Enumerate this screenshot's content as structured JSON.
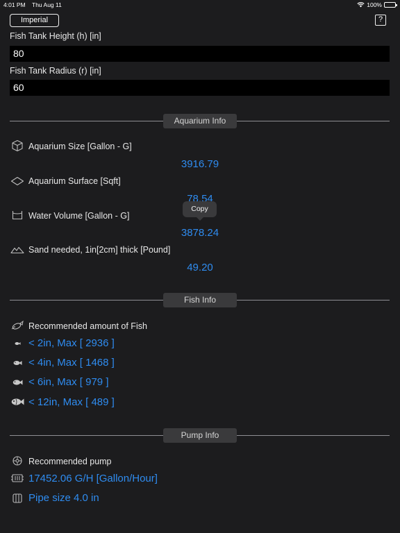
{
  "status_bar": {
    "time": "4:01 PM",
    "date": "Thu Aug 11",
    "battery": "100%"
  },
  "toolbar": {
    "unit_label": "Imperial",
    "help_label": "?"
  },
  "inputs": {
    "height": {
      "label": "Fish Tank Height (h) [in]",
      "value": "80"
    },
    "radius": {
      "label": "Fish Tank Radius (r) [in]",
      "value": "60"
    }
  },
  "aquarium": {
    "header": "Aquarium Info",
    "size": {
      "label": "Aquarium Size [Gallon - G]",
      "value": "3916.79",
      "icon": "cube-icon"
    },
    "surface": {
      "label": "Aquarium Surface [Sqft]",
      "value": "78.54",
      "icon": "diamond-icon"
    },
    "water": {
      "label": "Water Volume [Gallon - G]",
      "value": "3878.24",
      "icon": "tank-icon"
    },
    "sand": {
      "label": "Sand needed, 1in[2cm] thick [Pound]",
      "value": "49.20",
      "icon": "sand-icon"
    },
    "tooltip": "Copy"
  },
  "fish": {
    "header": "Fish Info",
    "title": "Recommended amount of Fish",
    "rows": [
      {
        "label": "< 2in, Max [ 2936 ]",
        "icon": "small-fish-icon"
      },
      {
        "label": "< 4in, Max [ 1468 ]",
        "icon": "fish-icon"
      },
      {
        "label": "< 6in, Max [ 979 ]",
        "icon": "fish-icon"
      },
      {
        "label": "< 12in, Max [ 489 ]",
        "icon": "large-fish-icon"
      }
    ]
  },
  "pump": {
    "header": "Pump Info",
    "title": "Recommended pump",
    "flow": "17452.06 G/H [Gallon/Hour]",
    "pipe": "Pipe size 4.0 in"
  },
  "colors": {
    "background": "#1c1c1e",
    "accent": "#2f8cf0",
    "pill": "#3a3a3c"
  }
}
